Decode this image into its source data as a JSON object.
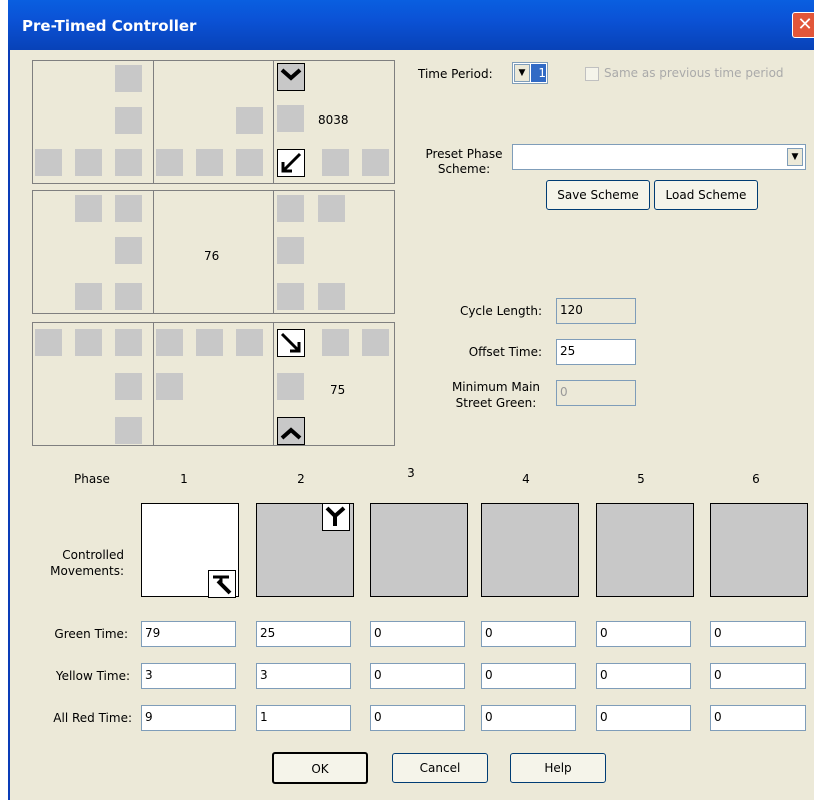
{
  "window": {
    "title": "Pre-Timed Controller",
    "close_glyph": "✕"
  },
  "intersection": {
    "volume_north": "8038",
    "volume_center": "76",
    "volume_south": "75"
  },
  "time_period": {
    "label": "Time Period:",
    "value": "1",
    "same_as_previous_label": "Same as previous time period"
  },
  "preset_scheme": {
    "label_line1": "Preset Phase",
    "label_line2": "Scheme:",
    "value": "",
    "save_label": "Save Scheme",
    "load_label": "Load Scheme"
  },
  "timing": {
    "cycle_length_label": "Cycle Length:",
    "cycle_length": "120",
    "offset_label": "Offset Time:",
    "offset": "25",
    "min_green_label_line1": "Minimum Main",
    "min_green_label_line2": "Street Green:",
    "min_green": "0"
  },
  "phases": {
    "header_label": "Phase",
    "controlled_label_line1": "Controlled",
    "controlled_label_line2": "Movements:",
    "green_label": "Green Time:",
    "yellow_label": "Yellow Time:",
    "allred_label": "All Red Time:",
    "numbers": [
      "1",
      "2",
      "3",
      "4",
      "5",
      "6"
    ],
    "green": [
      "79",
      "25",
      "0",
      "0",
      "0",
      "0"
    ],
    "yellow": [
      "3",
      "3",
      "0",
      "0",
      "0",
      "0"
    ],
    "allred": [
      "9",
      "1",
      "0",
      "0",
      "0",
      "0"
    ]
  },
  "footer": {
    "ok": "OK",
    "cancel": "Cancel",
    "help": "Help"
  },
  "colors": {
    "titlebar": "#0A5FE0",
    "dialog_bg": "#ECE9D8",
    "lane_square": "#C8C8C8",
    "selection": "#316AC5"
  }
}
